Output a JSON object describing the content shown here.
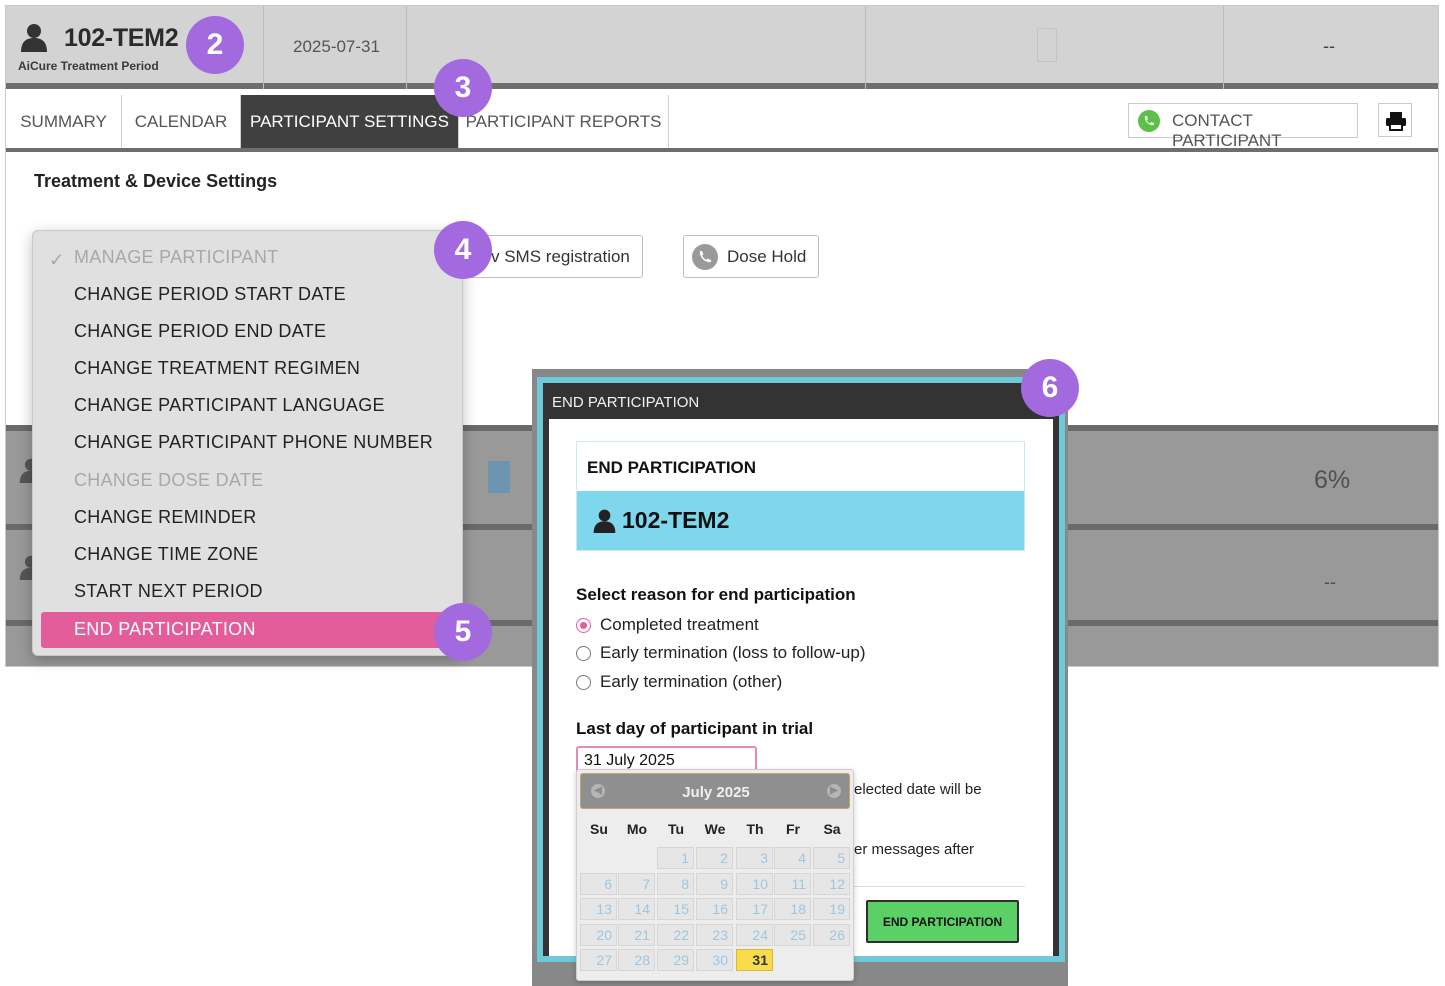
{
  "header": {
    "participant_id": "102-TEM2",
    "period_label": "AiCure Treatment Period",
    "date": "2025-07-31",
    "dash": "--"
  },
  "tabs": [
    {
      "label": "SUMMARY"
    },
    {
      "label": "CALENDAR"
    },
    {
      "label": "PARTICIPANT SETTINGS"
    },
    {
      "label": "PARTICIPANT REPORTS"
    }
  ],
  "toolbar": {
    "contact_label": "CONTACT PARTICIPANT"
  },
  "settings": {
    "section_title": "Treatment & Device Settings",
    "sms_button_label": "v SMS registration",
    "dose_hold_label": "Dose Hold"
  },
  "background_rows": {
    "percent": "6%",
    "dash": "--"
  },
  "menu": {
    "items": [
      {
        "label": "MANAGE PARTICIPANT"
      },
      {
        "label": "CHANGE PERIOD START DATE"
      },
      {
        "label": "CHANGE PERIOD END DATE"
      },
      {
        "label": "CHANGE TREATMENT REGIMEN"
      },
      {
        "label": "CHANGE PARTICIPANT LANGUAGE"
      },
      {
        "label": "CHANGE PARTICIPANT PHONE NUMBER"
      },
      {
        "label": "CHANGE DOSE DATE"
      },
      {
        "label": "CHANGE REMINDER"
      },
      {
        "label": "CHANGE TIME ZONE"
      },
      {
        "label": "START NEXT PERIOD"
      },
      {
        "label": "END PARTICIPATION"
      }
    ]
  },
  "badges": [
    "2",
    "3",
    "4",
    "5",
    "6"
  ],
  "modal": {
    "window_title": "END PARTICIPATION",
    "card_title": "END PARTICIPATION",
    "participant_id": "102-TEM2",
    "reason_label": "Select reason for end participation",
    "reasons": [
      {
        "label": "Completed treatment",
        "selected": true
      },
      {
        "label": "Early termination (loss to follow-up)",
        "selected": false
      },
      {
        "label": "Early termination (other)",
        "selected": false
      }
    ],
    "last_day_label": "Last day of participant in trial",
    "last_day_value": "31 July 2025",
    "hint_1": "elected date will be",
    "hint_2": "er messages after",
    "submit_label": "END PARTICIPATION"
  },
  "datepicker": {
    "month_label": "July 2025",
    "weekdays": [
      "Su",
      "Mo",
      "Tu",
      "We",
      "Th",
      "Fr",
      "Sa"
    ],
    "days": [
      "1",
      "2",
      "3",
      "4",
      "5",
      "6",
      "7",
      "8",
      "9",
      "10",
      "11",
      "12",
      "13",
      "14",
      "15",
      "16",
      "17",
      "18",
      "19",
      "20",
      "21",
      "22",
      "23",
      "24",
      "25",
      "26",
      "27",
      "28",
      "29",
      "30",
      "31"
    ],
    "selected_day": "31"
  }
}
